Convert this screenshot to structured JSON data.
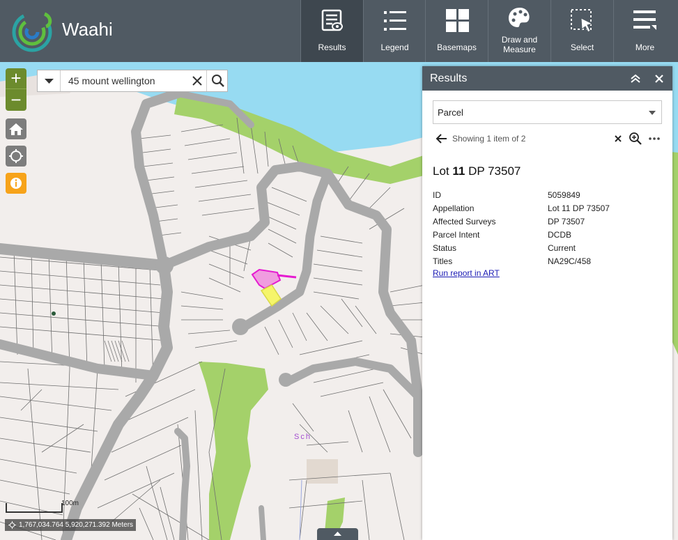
{
  "app": {
    "title": "Waahi"
  },
  "toolbar": {
    "items": [
      {
        "label": "Results",
        "icon": "results-icon",
        "active": true
      },
      {
        "label": "Legend",
        "icon": "legend-icon",
        "active": false
      },
      {
        "label": "Basemaps",
        "icon": "basemaps-icon",
        "active": false
      },
      {
        "label_line1": "Draw and",
        "label_line2": "Measure",
        "icon": "palette-icon",
        "active": false
      },
      {
        "label": "Select",
        "icon": "select-cursor-icon",
        "active": false
      },
      {
        "label": "More",
        "icon": "hamburger-icon",
        "active": false
      }
    ]
  },
  "search": {
    "value": "45 mount wellington"
  },
  "map": {
    "scale_label": "100m",
    "coordinates": "1,767,034.764 5,920,271.392 Meters",
    "label_sch": "Sch",
    "colors": {
      "land": "#f2eeec",
      "water": "#97dbf2",
      "park": "#a4d16a",
      "road": "#a9a9a9",
      "parcel_line": "#6e6e6e",
      "selected_fill": "#f09ce0",
      "selected_stroke": "#e51bd0",
      "highlight": "#f5f56a"
    }
  },
  "results": {
    "title": "Results",
    "layer": "Parcel",
    "showing": "Showing 1 item of 2",
    "feature_title_prefix": "Lot ",
    "feature_title_bold": "11",
    "feature_title_suffix": " DP 73507",
    "attributes": [
      {
        "key": "ID",
        "value": "5059849"
      },
      {
        "key": "Appellation",
        "value": "Lot 11 DP 73507"
      },
      {
        "key": "Affected Surveys",
        "value": "DP 73507"
      },
      {
        "key": "Parcel Intent",
        "value": "DCDB"
      },
      {
        "key": "Status",
        "value": "Current"
      },
      {
        "key": "Titles",
        "value": "NA29C/458"
      }
    ],
    "report_link": "Run report in ART"
  }
}
